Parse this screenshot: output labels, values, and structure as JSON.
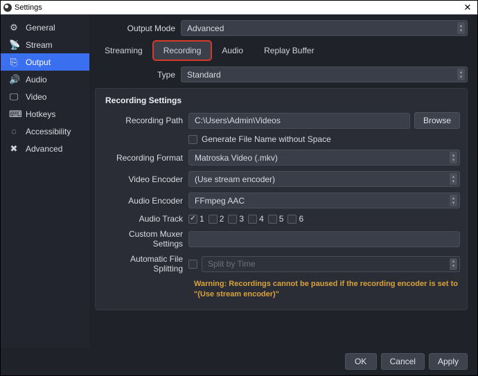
{
  "window": {
    "title": "Settings"
  },
  "sidebar": {
    "items": [
      {
        "label": "General"
      },
      {
        "label": "Stream"
      },
      {
        "label": "Output"
      },
      {
        "label": "Audio"
      },
      {
        "label": "Video"
      },
      {
        "label": "Hotkeys"
      },
      {
        "label": "Accessibility"
      },
      {
        "label": "Advanced"
      }
    ]
  },
  "output_mode": {
    "label": "Output Mode",
    "value": "Advanced"
  },
  "tabs": {
    "streaming": "Streaming",
    "recording": "Recording",
    "audio": "Audio",
    "replay": "Replay Buffer"
  },
  "type_row": {
    "label": "Type",
    "value": "Standard"
  },
  "panel": {
    "title": "Recording Settings",
    "path_label": "Recording Path",
    "path_value": "C:\\Users\\Admin\\Videos",
    "browse": "Browse",
    "gen_filename": "Generate File Name without Space",
    "format_label": "Recording Format",
    "format_value": "Matroska Video (.mkv)",
    "venc_label": "Video Encoder",
    "venc_value": "(Use stream encoder)",
    "aenc_label": "Audio Encoder",
    "aenc_value": "FFmpeg AAC",
    "track_label": "Audio Track",
    "tracks": [
      "1",
      "2",
      "3",
      "4",
      "5",
      "6"
    ],
    "muxer_label": "Custom Muxer Settings",
    "muxer_value": "",
    "split_label": "Automatic File Splitting",
    "split_value": "Split by Time",
    "warning": "Warning: Recordings cannot be paused if the recording encoder is set to \"(Use stream encoder)\""
  },
  "buttons": {
    "ok": "OK",
    "cancel": "Cancel",
    "apply": "Apply"
  }
}
